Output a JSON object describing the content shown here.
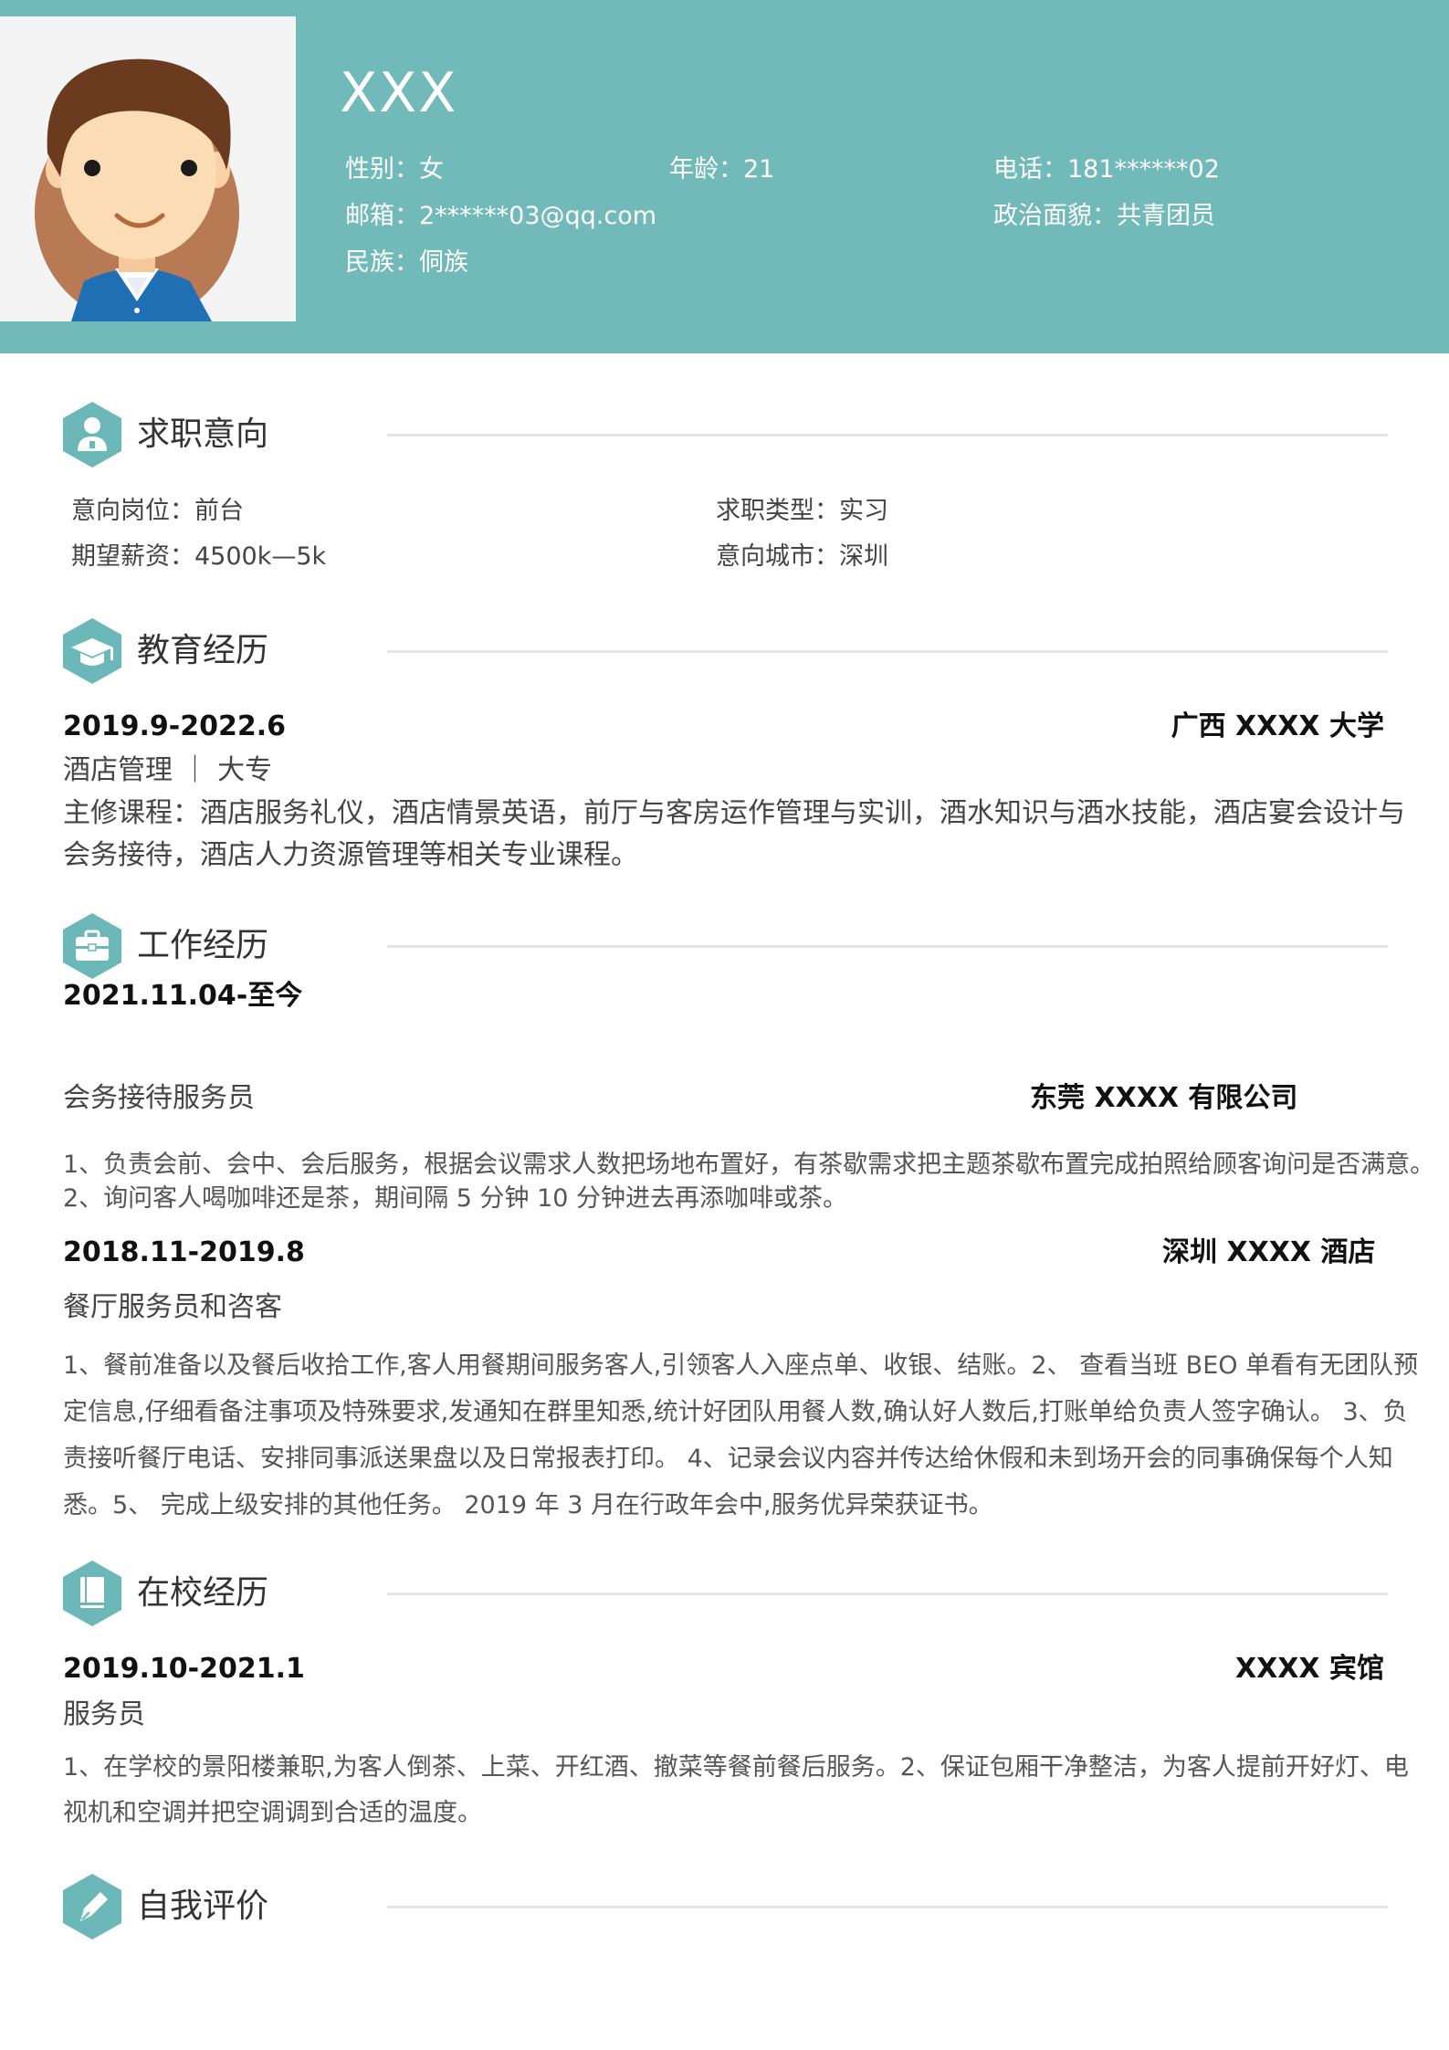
{
  "header": {
    "name": "XXX",
    "gender": "性别：女",
    "age": "年龄：21",
    "phone": "电话：181******02",
    "email": "邮箱：2******03@qq.com",
    "politics": "政治面貌：共青团员",
    "ethnicity": "民族：侗族"
  },
  "job_intention": {
    "title": "求职意向",
    "position": "意向岗位：前台",
    "type": "求职类型：实习",
    "salary": "期望薪资：4500k—5k",
    "city": "意向城市：深圳"
  },
  "education": {
    "title": "教育经历",
    "period": "2019.9-2022.6",
    "school": "广西 XXXX 大学",
    "major": "酒店管理 ｜ 大专",
    "courses_line1": "主修课程：酒店服务礼仪，酒店情景英语，前厅与客房运作管理与实训，酒水知识与酒水技能，酒店宴会设计与",
    "courses_line2": "会务接待，酒店人力资源管理等相关专业课程。"
  },
  "work": {
    "title": "工作经历",
    "jobs": [
      {
        "period": "2021.11.04-至今",
        "role": "会务接待服务员",
        "company": "东莞 XXXX 有限公司",
        "lines": [
          "1、负责会前、会中、会后服务，根据会议需求人数把场地布置好，有茶歇需求把主题茶歇布置完成拍照给顾客询问是否满意。",
          "2、询问客人喝咖啡还是茶，期间隔 5 分钟 10 分钟进去再添咖啡或茶。"
        ]
      },
      {
        "period": "2018.11-2019.8",
        "role": "餐厅服务员和咨客",
        "company": "深圳 XXXX 酒店",
        "lines": [
          "1、餐前准备以及餐后收拾工作,客人用餐期间服务客人,引领客人入座点单、收银、结账。2、 查看当班 BEO 单看有无团队预",
          "定信息,仔细看备注事项及特殊要求,发通知在群里知悉,统计好团队用餐人数,确认好人数后,打账单给负责人签字确认。 3、负",
          "责接听餐厅电话、安排同事派送果盘以及日常报表打印。 4、记录会议内容并传达给休假和未到场开会的同事确保每个人知",
          "悉。5、 完成上级安排的其他任务。 2019 年 3 月在行政年会中,服务优异荣获证书。"
        ]
      }
    ]
  },
  "campus": {
    "title": "在校经历",
    "period": "2019.10-2021.1",
    "org": "XXXX 宾馆",
    "role": "服务员",
    "lines": [
      "1、在学校的景阳楼兼职,为客人倒茶、上菜、开红酒、撤菜等餐前餐后服务。2、保证包厢干净整洁，为客人提前开好灯、电",
      "视机和空调并把空调调到合适的温度。"
    ]
  },
  "self_eval": {
    "title": "自我评价"
  },
  "colors": {
    "header_bg": "#72b9b9",
    "accent": "#6cb7b8",
    "divider": "#e6e6e6"
  },
  "icons": {
    "job_intention": "person-icon",
    "education": "graduation-cap-icon",
    "work": "briefcase-icon",
    "campus": "book-icon",
    "self_eval": "pen-icon"
  }
}
